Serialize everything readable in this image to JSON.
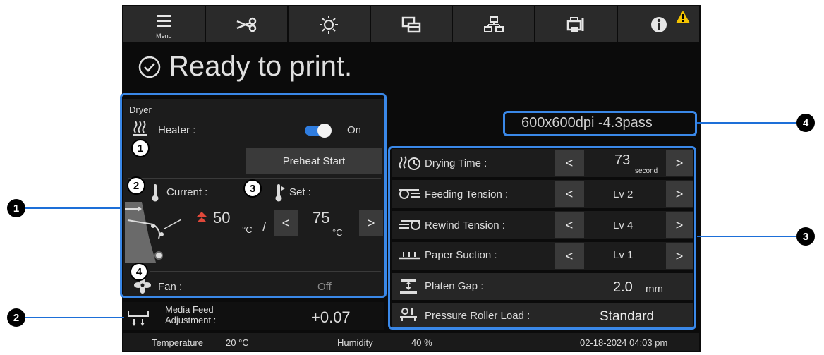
{
  "toolbar": {
    "menu_label": "Menu",
    "icons": [
      "menu-icon",
      "scissors-icon",
      "sun-icon",
      "windows-icon",
      "network-icon",
      "printer-maintenance-icon",
      "info-icon"
    ]
  },
  "status": {
    "text": "Ready to print."
  },
  "mode": {
    "text": "600x600dpi -4.3pass"
  },
  "dryer": {
    "title": "Dryer",
    "heater_label": "Heater :",
    "heater_state": "On",
    "preheat_label": "Preheat Start",
    "current_label": "Current :",
    "set_label": "Set :",
    "current_value": "50",
    "set_value": "75",
    "unit": "°C",
    "separator": "/",
    "fan_label": "Fan :",
    "fan_value": "Off"
  },
  "settings": [
    {
      "label": "Drying Time :",
      "value": "73",
      "sub": "second"
    },
    {
      "label": "Feeding Tension :",
      "value": "Lv 2",
      "sub": ""
    },
    {
      "label": "Rewind Tension :",
      "value": "Lv 4",
      "sub": ""
    },
    {
      "label": "Paper Suction :",
      "value": "Lv 1",
      "sub": ""
    }
  ],
  "platen": {
    "label": "Platen Gap :",
    "value": "2.0",
    "unit": "mm"
  },
  "pressure": {
    "label": "Pressure Roller Load :",
    "value": "Standard"
  },
  "media_feed": {
    "label_1": "Media Feed",
    "label_2": "Adjustment :",
    "value": "+0.07"
  },
  "footer": {
    "temp_label": "Temperature",
    "temp_value": "20 °C",
    "hum_label": "Humidity",
    "hum_value": "40 %",
    "datetime": "02-18-2024 04:03 pm"
  },
  "callouts": {
    "c1": "1",
    "c2": "2",
    "c3": "3",
    "c4": "4",
    "d1": "1",
    "d2": "2",
    "d3": "3",
    "d4": "4"
  },
  "arrows": {
    "left": "<",
    "right": ">"
  },
  "colors": {
    "accent": "#3a88e8",
    "warning": "#f5c400",
    "toggle": "#2f7de0",
    "temp_arrow": "#e0483a"
  }
}
